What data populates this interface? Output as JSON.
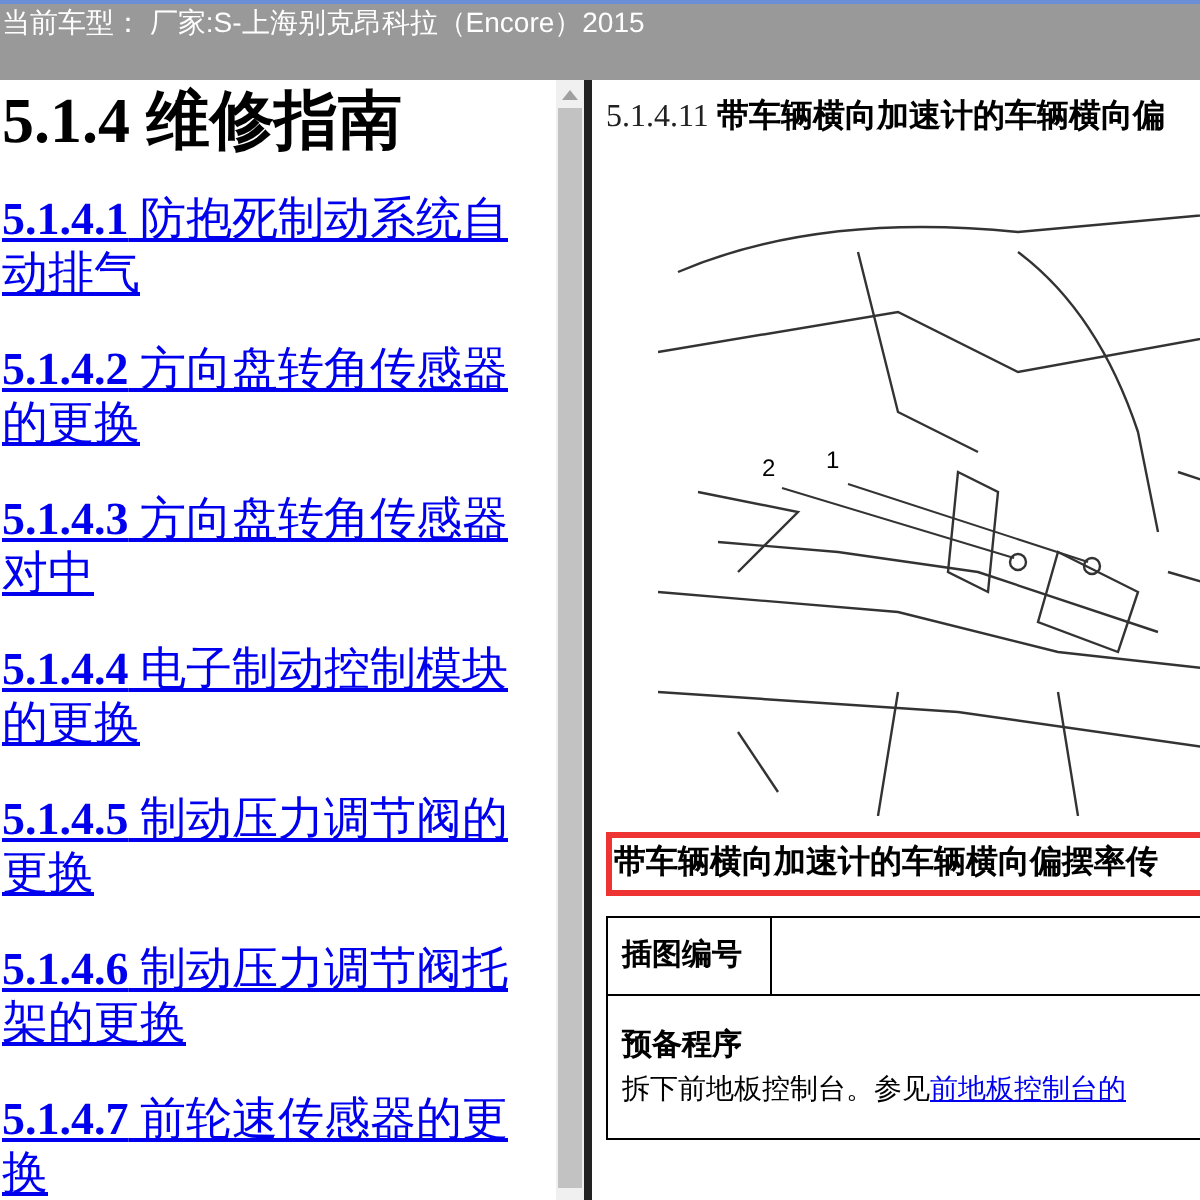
{
  "header": {
    "title": "当前车型：  厂家:S-上海别克昂科拉（Encore）2015"
  },
  "left_pane": {
    "heading": "5.1.4 维修指南",
    "links": [
      {
        "number": "5.1.4.1",
        "text": "防抱死制动系统自动排气"
      },
      {
        "number": "5.1.4.2",
        "text": "方向盘转角传感器的更换"
      },
      {
        "number": "5.1.4.3",
        "text": "方向盘转角传感器对中"
      },
      {
        "number": "5.1.4.4",
        "text": "电子制动控制模块的更换"
      },
      {
        "number": "5.1.4.5",
        "text": "制动压力调节阀的更换"
      },
      {
        "number": "5.1.4.6",
        "text": "制动压力调节阀托架的更换"
      },
      {
        "number": "5.1.4.7",
        "text": "前轮速传感器的更换"
      }
    ]
  },
  "right_pane": {
    "section_number": "5.1.4.11",
    "section_title": "带车辆横向加速计的车辆横向偏",
    "illustration": {
      "callouts": [
        "2",
        "1"
      ]
    },
    "caption": "带车辆横向加速计的车辆横向偏摆率传",
    "table": {
      "rows": [
        {
          "label": "插图编号",
          "value": ""
        },
        {
          "heading": "预备程序",
          "text": "拆下前地板控制台。参见",
          "link": "前地板控制台的"
        }
      ]
    }
  }
}
